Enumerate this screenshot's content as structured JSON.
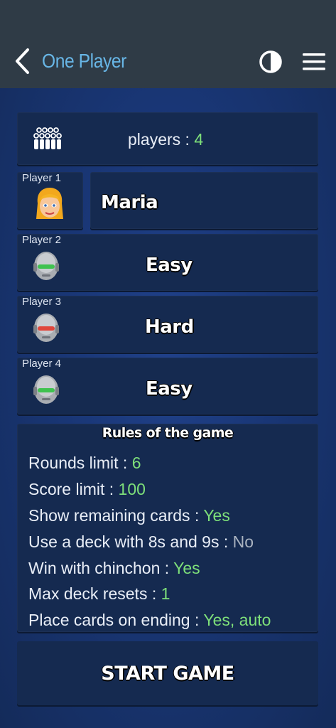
{
  "header": {
    "title": "One Player",
    "back_icon": "chevron-left-icon",
    "contrast_icon": "contrast-icon",
    "menu_icon": "hamburger-menu-icon"
  },
  "players": {
    "label": "players : ",
    "count": "4",
    "icon": "group-icon"
  },
  "slots": [
    {
      "label": "Player 1",
      "name": "Maria",
      "avatar": "girl-avatar-icon"
    },
    {
      "label": "Player 2",
      "name": "Easy",
      "avatar": "robot-green-icon"
    },
    {
      "label": "Player 3",
      "name": "Hard",
      "avatar": "robot-red-icon"
    },
    {
      "label": "Player 4",
      "name": "Easy",
      "avatar": "robot-green-icon"
    }
  ],
  "rules": {
    "title": "Rules of the game",
    "items": [
      {
        "label": "Rounds limit : ",
        "value": "6"
      },
      {
        "label": "Score limit : ",
        "value": "100"
      },
      {
        "label": "Show remaining cards : ",
        "value": "Yes"
      },
      {
        "label": "Use a deck with 8s and 9s : ",
        "value": "No"
      },
      {
        "label": "Win with chinchon : ",
        "value": "Yes"
      },
      {
        "label": "Max deck resets : ",
        "value": "1"
      },
      {
        "label": "Place cards on ending : ",
        "value": "Yes, auto"
      }
    ]
  },
  "start_button": "START GAME",
  "colors": {
    "accent": "#68b6e6",
    "value_green": "#7ee07a",
    "value_gray": "#aab3c0"
  }
}
